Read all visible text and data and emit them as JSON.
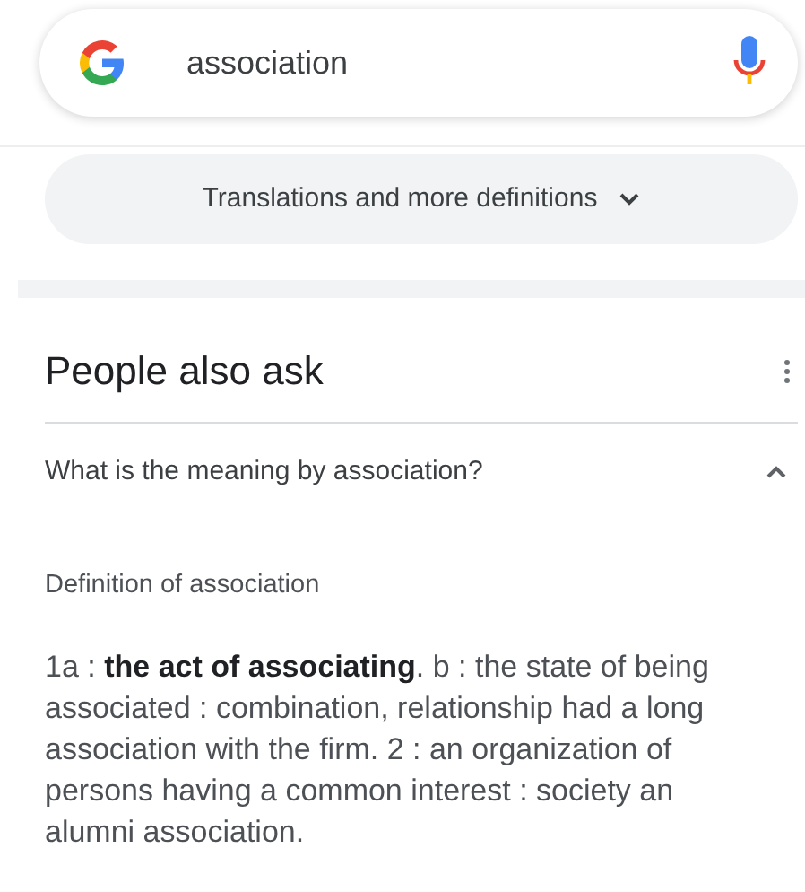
{
  "search": {
    "value": "association"
  },
  "translations_button": {
    "label": "Translations and more definitions"
  },
  "people_also_ask": {
    "title": "People also ask",
    "questions": [
      {
        "text": "What is the meaning by association?",
        "expanded": true
      }
    ]
  },
  "answer": {
    "heading": "Definition of association",
    "body": " 1a : **the act of associating**. b : the state of being associated : combination, relationship had a long association with the firm. 2 : an organization of persons having a common interest : society an alumni association."
  }
}
